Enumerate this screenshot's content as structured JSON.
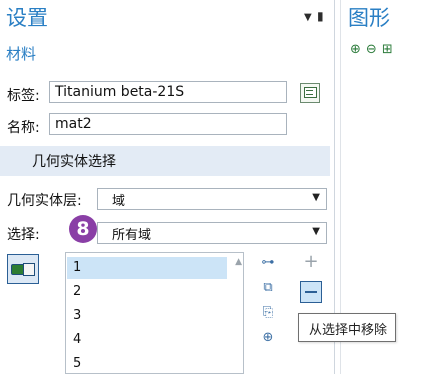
{
  "settings": {
    "title": "设置",
    "subtitle": "材料",
    "label_field": {
      "label": "标签:",
      "value": "Titanium beta-21S"
    },
    "name_field": {
      "label": "名称:",
      "value": "mat2"
    }
  },
  "graphics": {
    "title": "图形",
    "tools": [
      "zoom-in-icon",
      "zoom-out-icon",
      "zoom-box-icon"
    ]
  },
  "geometric_selection": {
    "section_title": "几何实体选择",
    "entity_level_label": "几何实体层:",
    "entity_level_value": "域",
    "selection_label": "选择:",
    "selection_value": "所有域",
    "step_badge": "8",
    "items": [
      "1",
      "2",
      "3",
      "4",
      "5"
    ],
    "selected_item": "1"
  },
  "tooltip": {
    "text": "从选择中移除"
  },
  "colors": {
    "accent_blue": "#2a7fc4",
    "section_bg": "#e3ebf5",
    "badge_purple": "#8a3fa6",
    "selected_row": "#cce4f7"
  }
}
